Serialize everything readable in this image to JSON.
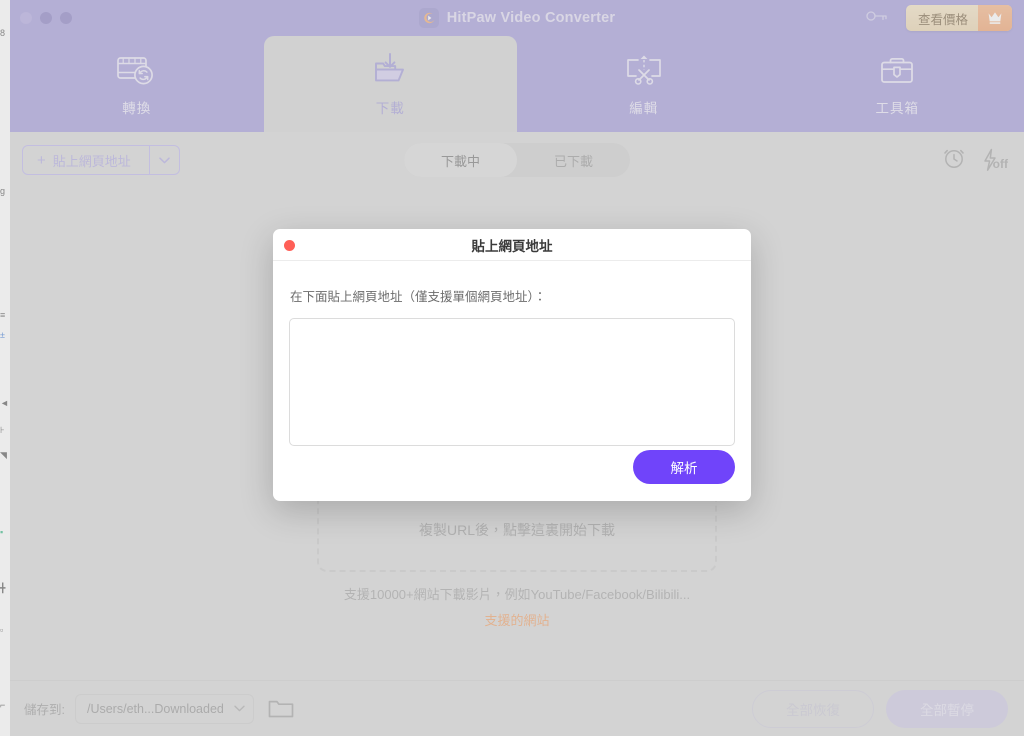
{
  "window": {
    "title": "HitPaw Video Converter",
    "logo_icon": "hitpaw-logo-icon",
    "traffic_lights": [
      "close",
      "minimize",
      "maximize"
    ]
  },
  "titlebar": {
    "key_icon": "key-icon",
    "pricing_label": "查看價格",
    "crown_icon": "crown-icon"
  },
  "nav": {
    "tabs": [
      {
        "label": "轉換",
        "icon": "film-convert-icon",
        "active": false
      },
      {
        "label": "下載",
        "icon": "download-folder-icon",
        "active": true
      },
      {
        "label": "編輯",
        "icon": "scissors-edit-icon",
        "active": false
      },
      {
        "label": "工具箱",
        "icon": "toolbox-icon",
        "active": false
      }
    ]
  },
  "toolbar": {
    "paste_url_label": "貼上網頁地址",
    "paste_url_plus": "+",
    "caret_icon": "chevron-down-icon",
    "segments": [
      {
        "label": "下載中",
        "active": true
      },
      {
        "label": "已下載",
        "active": false
      }
    ],
    "schedule_icon": "alarm-clock-icon",
    "turbo_icon": "lightning-off-icon",
    "turbo_state_label": "off"
  },
  "content": {
    "drop_zone_text": "複製URL後，點擊這裏開始下載",
    "support_text": "支援10000+網站下載影片，例如YouTube/Facebook/Bilibili...",
    "supported_sites_link": "支援的網站"
  },
  "bottom": {
    "save_to_label": "儲存到:",
    "save_path": "/Users/eth...Downloaded",
    "caret_icon": "chevron-down-icon",
    "folder_icon": "open-folder-icon",
    "resume_all_label": "全部恢復",
    "pause_all_label": "全部暫停"
  },
  "modal": {
    "title": "貼上網頁地址",
    "close_icon": "close-dot-icon",
    "prompt": "在下面貼上網頁地址（僅支援單個網頁地址）：",
    "textarea_value": "",
    "textarea_placeholder": "",
    "parse_label": "解析"
  },
  "colors": {
    "header_purple": "#9b93d8",
    "app_gray": "#d4d4d4",
    "accent_purple": "#7044fa",
    "link_orange": "#ef9759",
    "close_red": "#ff5f57",
    "pricing_gold": "#ecd2a8"
  },
  "behind_window_fragments": [
    "8",
    "g",
    "≡",
    "±",
    "◄",
    "⊦",
    "◥",
    "▪",
    "╋",
    "▫",
    "⌐"
  ]
}
